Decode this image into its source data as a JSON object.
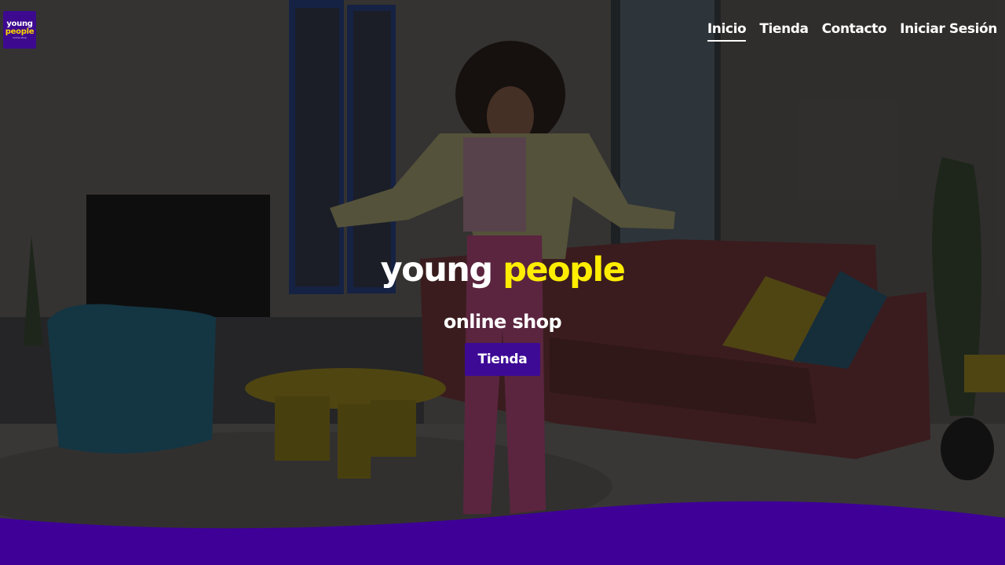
{
  "logo": {
    "line1": "young",
    "line2": "people",
    "tagline": "online shop"
  },
  "nav": {
    "items": [
      {
        "label": "Inicio",
        "active": true
      },
      {
        "label": "Tienda",
        "active": false
      },
      {
        "label": "Contacto",
        "active": false
      },
      {
        "label": "Iniciar Sesión",
        "active": false
      }
    ]
  },
  "hero": {
    "brand_word1": "young",
    "brand_word2": "people",
    "subtitle": "online shop",
    "button_label": "Tienda"
  },
  "colors": {
    "brand_purple": "#3d0a96",
    "brand_yellow": "#ffee00",
    "wave_purple": "#3f0098"
  }
}
